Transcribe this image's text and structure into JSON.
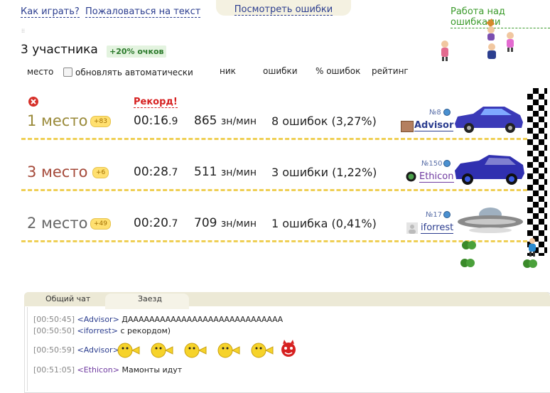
{
  "top": {
    "how_to_play": "Как играть?",
    "complain": "Пожаловаться на текст",
    "view_errors": "Посмотреть ошибки",
    "work_on_errors": "Работа над ошибками"
  },
  "summary": {
    "participants": "3 участника",
    "bonus": "+20% очков"
  },
  "headers": {
    "place": "место",
    "auto_update": "обновлять автоматически",
    "nick": "ник",
    "errors": "ошибки",
    "percent_errors": "% ошибок",
    "rating": "рейтинг"
  },
  "record_label": "Рекорд!",
  "players": [
    {
      "place": "1 место",
      "place_color": "#9a8a3a",
      "bonus": "+83",
      "time_main": "00:16",
      "time_frac": ".9",
      "speed": "865",
      "speed_unit": "зн/мин",
      "errors": "8 ошибок (3,27%)",
      "rank": "№8",
      "nick": "Advisor",
      "nick_color": "#2b3d8f",
      "car_color": "#3b3ab8"
    },
    {
      "place": "3 место",
      "place_color": "#a54a3a",
      "bonus": "+6",
      "time_main": "00:28",
      "time_frac": ".7",
      "speed": "511",
      "speed_unit": "зн/мин",
      "errors": "3 ошибки (1,22%)",
      "rank": "№150",
      "nick": "Ethicon",
      "nick_color": "#6f3aa0",
      "car_color": "#3030b0"
    },
    {
      "place": "2 место",
      "place_color": "#666666",
      "bonus": "+49",
      "time_main": "00:20",
      "time_frac": ".7",
      "speed": "709",
      "speed_unit": "зн/мин",
      "errors": "1 ошибка (0,41%)",
      "rank": "№17",
      "nick": "iforrest",
      "nick_color": "#2b3d8f",
      "car_color": "#888888"
    }
  ],
  "chat": {
    "tab_general": "Общий чат",
    "tab_race": "Заезд",
    "messages": [
      {
        "time": "[00:50:45]",
        "user": "<Advisor>",
        "text": "ДААААААААААААААААААААААААААААА"
      },
      {
        "time": "[00:50:50]",
        "user": "<iforrest>",
        "text": "с рекордом)"
      },
      {
        "time": "[00:50:59]",
        "user": "<Advisor>",
        "text": ""
      },
      {
        "time": "[00:51:05]",
        "user": "<Ethicon>",
        "text": "Мамонты идут"
      }
    ]
  }
}
